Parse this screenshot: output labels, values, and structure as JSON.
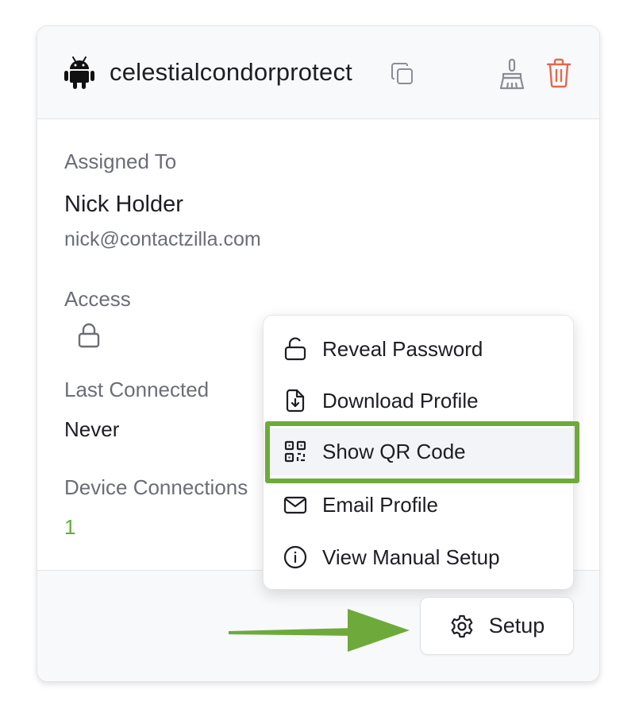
{
  "device": {
    "name": "celestialcondorprotect",
    "platform_icon": "android-icon"
  },
  "header_actions": {
    "copy_icon": "copy-icon",
    "clear_icon": "broom-icon",
    "delete_icon": "trash-icon",
    "delete_color": "#e0694f"
  },
  "details": {
    "assigned_label": "Assigned To",
    "user_name": "Nick Holder",
    "user_email": "nick@contactzilla.com",
    "access_label": "Access",
    "access_icon": "lock-icon",
    "last_connected_label": "Last Connected",
    "last_connected_value": "Never",
    "device_connections_label": "Device Connections",
    "device_connections_value": "1"
  },
  "menu": {
    "items": [
      {
        "label": "Reveal Password",
        "icon": "unlock-icon"
      },
      {
        "label": "Download Profile",
        "icon": "file-download-icon"
      },
      {
        "label": "Show QR Code",
        "icon": "qr-code-icon",
        "highlighted": true
      },
      {
        "label": "Email Profile",
        "icon": "envelope-icon"
      },
      {
        "label": "View Manual Setup",
        "icon": "info-icon"
      }
    ]
  },
  "footer": {
    "setup_label": "Setup",
    "setup_icon": "gear-icon"
  },
  "colors": {
    "annotation_green": "#6daa3b",
    "connections_green": "#5bb035",
    "text_primary": "#1d1e24",
    "text_secondary": "#6b6e76"
  }
}
